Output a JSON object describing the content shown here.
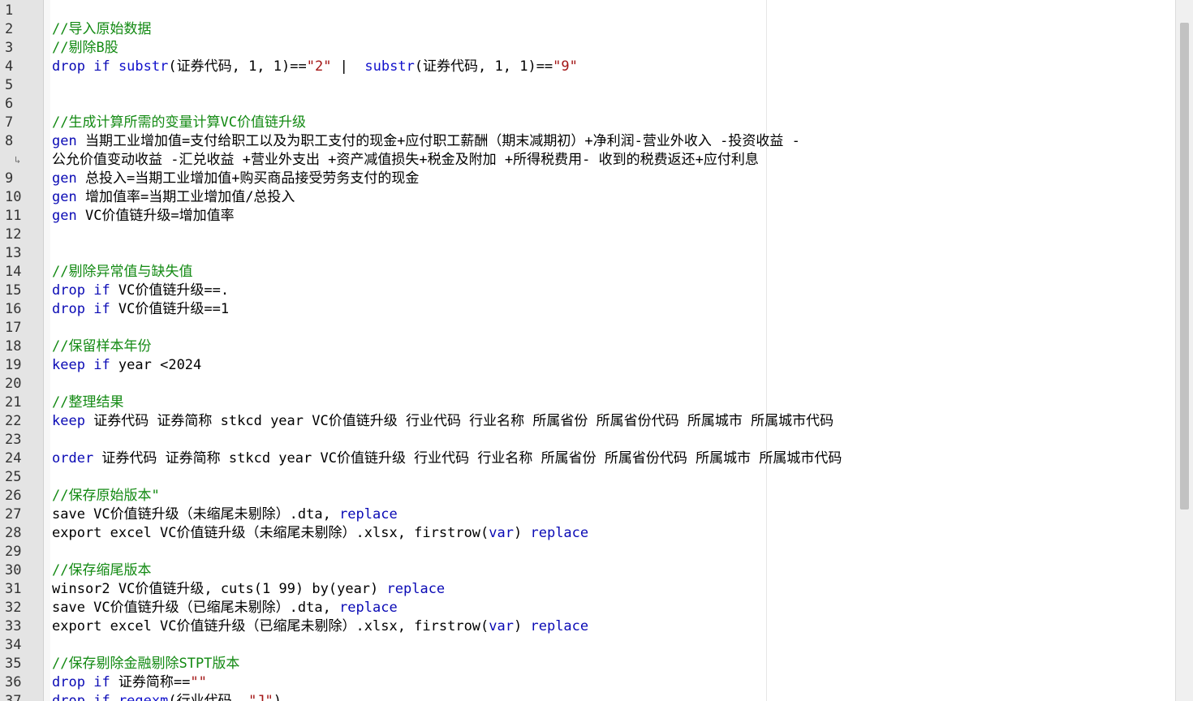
{
  "editor": {
    "lines": [
      {
        "n": "1",
        "tokens": []
      },
      {
        "n": "2",
        "tokens": [
          {
            "t": "//导入原始数据",
            "c": "cm"
          }
        ]
      },
      {
        "n": "3",
        "tokens": [
          {
            "t": "//剔除B股",
            "c": "cm"
          }
        ]
      },
      {
        "n": "4",
        "tokens": [
          {
            "t": "drop",
            "c": "kw"
          },
          {
            "t": " "
          },
          {
            "t": "if",
            "c": "kw"
          },
          {
            "t": " "
          },
          {
            "t": "substr",
            "c": "fn"
          },
          {
            "t": "(证券代码, 1, 1)=="
          },
          {
            "t": "\"2\"",
            "c": "str"
          },
          {
            "t": " |  "
          },
          {
            "t": "substr",
            "c": "fn"
          },
          {
            "t": "(证券代码, 1, 1)=="
          },
          {
            "t": "\"9\"",
            "c": "str"
          }
        ]
      },
      {
        "n": "5",
        "tokens": []
      },
      {
        "n": "6",
        "tokens": []
      },
      {
        "n": "7",
        "tokens": [
          {
            "t": "//生成计算所需的变量计算VC价值链升级",
            "c": "cm"
          }
        ]
      },
      {
        "n": "8",
        "tokens": [
          {
            "t": "gen",
            "c": "kw"
          },
          {
            "t": " 当期工业增加值=支付给职工以及为职工支付的现金+应付职工薪酬（期末减期初）+净利润-营业外收入 -投资收益 -"
          }
        ]
      },
      {
        "n": "↳",
        "wrap": true,
        "tokens": [
          {
            "t": "公允价值变动收益 -汇兑收益 +营业外支出 +资产减值损失+税金及附加 +所得税费用- 收到的税费返还+应付利息"
          }
        ]
      },
      {
        "n": "9",
        "tokens": [
          {
            "t": "gen",
            "c": "kw"
          },
          {
            "t": " 总投入=当期工业增加值+购买商品接受劳务支付的现金"
          }
        ]
      },
      {
        "n": "10",
        "tokens": [
          {
            "t": "gen",
            "c": "kw"
          },
          {
            "t": " 增加值率=当期工业增加值/总投入"
          }
        ]
      },
      {
        "n": "11",
        "tokens": [
          {
            "t": "gen",
            "c": "kw"
          },
          {
            "t": " VC价值链升级=增加值率"
          }
        ]
      },
      {
        "n": "12",
        "tokens": []
      },
      {
        "n": "13",
        "tokens": []
      },
      {
        "n": "14",
        "tokens": [
          {
            "t": "//剔除异常值与缺失值",
            "c": "cm"
          }
        ]
      },
      {
        "n": "15",
        "tokens": [
          {
            "t": "drop",
            "c": "kw"
          },
          {
            "t": " "
          },
          {
            "t": "if",
            "c": "kw"
          },
          {
            "t": " VC价值链升级==."
          }
        ]
      },
      {
        "n": "16",
        "tokens": [
          {
            "t": "drop",
            "c": "kw"
          },
          {
            "t": " "
          },
          {
            "t": "if",
            "c": "kw"
          },
          {
            "t": " VC价值链升级==1"
          }
        ]
      },
      {
        "n": "17",
        "tokens": []
      },
      {
        "n": "18",
        "tokens": [
          {
            "t": "//保留样本年份",
            "c": "cm"
          }
        ]
      },
      {
        "n": "19",
        "tokens": [
          {
            "t": "keep",
            "c": "kw"
          },
          {
            "t": " "
          },
          {
            "t": "if",
            "c": "kw"
          },
          {
            "t": " year <2024"
          }
        ]
      },
      {
        "n": "20",
        "tokens": []
      },
      {
        "n": "21",
        "tokens": [
          {
            "t": "//整理结果",
            "c": "cm"
          }
        ]
      },
      {
        "n": "22",
        "tokens": [
          {
            "t": "keep",
            "c": "kw"
          },
          {
            "t": " 证券代码 证券简称 stkcd year VC价值链升级 行业代码 行业名称 所属省份 所属省份代码 所属城市 所属城市代码"
          }
        ]
      },
      {
        "n": "23",
        "tokens": []
      },
      {
        "n": "24",
        "tokens": [
          {
            "t": "order",
            "c": "kw"
          },
          {
            "t": " 证券代码 证券简称 stkcd year VC价值链升级 行业代码 行业名称 所属省份 所属省份代码 所属城市 所属城市代码"
          }
        ]
      },
      {
        "n": "25",
        "tokens": []
      },
      {
        "n": "26",
        "tokens": [
          {
            "t": "//保存原始版本\"",
            "c": "cm"
          }
        ]
      },
      {
        "n": "27",
        "tokens": [
          {
            "t": "save VC价值链升级（未缩尾未剔除）.dta, "
          },
          {
            "t": "replace",
            "c": "kw"
          }
        ]
      },
      {
        "n": "28",
        "tokens": [
          {
            "t": "export excel VC价值链升级（未缩尾未剔除）.xlsx, firstrow("
          },
          {
            "t": "var",
            "c": "kw"
          },
          {
            "t": ") "
          },
          {
            "t": "replace",
            "c": "kw"
          }
        ]
      },
      {
        "n": "29",
        "tokens": []
      },
      {
        "n": "30",
        "tokens": [
          {
            "t": "//保存缩尾版本",
            "c": "cm"
          }
        ]
      },
      {
        "n": "31",
        "tokens": [
          {
            "t": "winsor2 VC价值链升级, cuts(1 99) by(year) "
          },
          {
            "t": "replace",
            "c": "kw"
          }
        ]
      },
      {
        "n": "32",
        "tokens": [
          {
            "t": "save VC价值链升级（已缩尾未剔除）.dta, "
          },
          {
            "t": "replace",
            "c": "kw"
          }
        ]
      },
      {
        "n": "33",
        "tokens": [
          {
            "t": "export excel VC价值链升级（已缩尾未剔除）.xlsx, firstrow("
          },
          {
            "t": "var",
            "c": "kw"
          },
          {
            "t": ") "
          },
          {
            "t": "replace",
            "c": "kw"
          }
        ]
      },
      {
        "n": "34",
        "tokens": []
      },
      {
        "n": "35",
        "tokens": [
          {
            "t": "//保存剔除金融剔除STPT版本",
            "c": "cm"
          }
        ]
      },
      {
        "n": "36",
        "tokens": [
          {
            "t": "drop",
            "c": "kw"
          },
          {
            "t": " "
          },
          {
            "t": "if",
            "c": "kw"
          },
          {
            "t": " 证券简称=="
          },
          {
            "t": "\"\"",
            "c": "str"
          }
        ]
      },
      {
        "n": "37",
        "tokens": [
          {
            "t": "drop",
            "c": "kw"
          },
          {
            "t": " "
          },
          {
            "t": "if",
            "c": "kw"
          },
          {
            "t": " "
          },
          {
            "t": "regexm",
            "c": "fn"
          },
          {
            "t": "(行业代码, "
          },
          {
            "t": "\"J\"",
            "c": "str"
          },
          {
            "t": ")"
          }
        ]
      }
    ]
  },
  "colors": {
    "keyword": "#0a0ab5",
    "function": "#1111cc",
    "string": "#a31515",
    "comment": "#138a13",
    "gutter": "#e4e4e4"
  }
}
